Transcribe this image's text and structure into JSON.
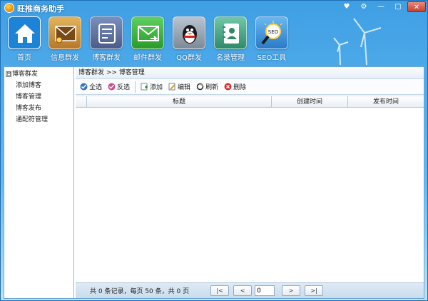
{
  "window": {
    "title": "旺推商务助手",
    "buttons": [
      "♥",
      "⚙",
      "—",
      "▢",
      "✕"
    ]
  },
  "nav": [
    {
      "label": "首页",
      "icon": "home-icon",
      "color": "#1d83d6"
    },
    {
      "label": "信息群发",
      "icon": "message-icon",
      "color": "#d39a3c"
    },
    {
      "label": "博客群发",
      "icon": "blog-icon",
      "color": "#5a6e9e"
    },
    {
      "label": "邮件群发",
      "icon": "mail-icon",
      "color": "#3cb43c"
    },
    {
      "label": "QQ群发",
      "icon": "qq-icon",
      "color": "#8c9aa8"
    },
    {
      "label": "名录管理",
      "icon": "contacts-icon",
      "color": "#4aa88a"
    },
    {
      "label": "SEO工具",
      "icon": "seo-icon",
      "color": "#3b8fd8"
    }
  ],
  "tree": {
    "root": "博客群发",
    "toggle": "⊟",
    "items": [
      "添加博客",
      "博客管理",
      "博客发布",
      "通配符管理"
    ]
  },
  "breadcrumb": "博客群发 >> 博客管理",
  "toolbar": {
    "select_all": "全选",
    "invert": "反选",
    "add": "添加",
    "edit": "编辑",
    "refresh": "刷新",
    "delete": "删除"
  },
  "grid": {
    "columns": [
      "标题",
      "创建时间",
      "发布时间"
    ],
    "rows": []
  },
  "pager": {
    "info": "共 0 条记录，每页 50 条，共 0 页",
    "first": "|<",
    "prev": "<",
    "page": "0",
    "next": ">",
    "last": ">|"
  }
}
